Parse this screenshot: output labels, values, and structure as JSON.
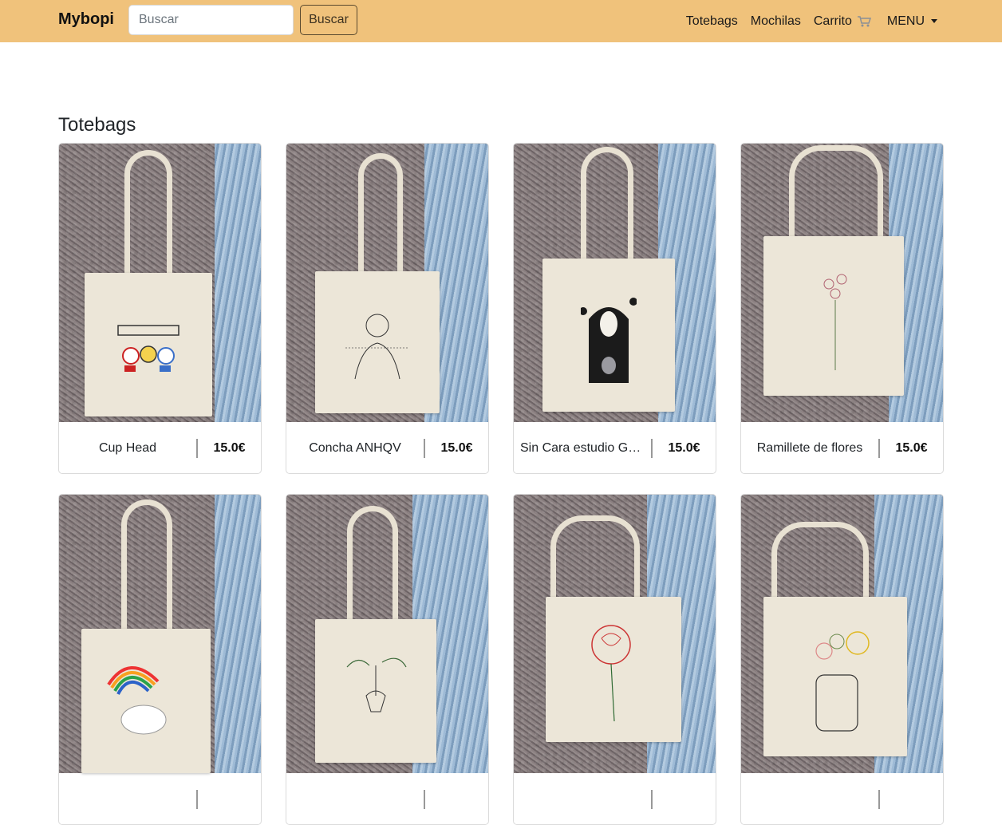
{
  "navbar": {
    "brand": "Mybopi",
    "search_placeholder": "Buscar",
    "search_button": "Buscar",
    "links": [
      "Totebags",
      "Mochilas",
      "Carrito",
      "MENU"
    ],
    "cart_icon": "cart-icon",
    "menu_icon": "caret-down-icon",
    "background": "#f0c27b"
  },
  "main": {
    "section_title": "Totebags",
    "products": [
      {
        "name": "Cup Head",
        "price": "15.0€"
      },
      {
        "name": "Concha ANHQV",
        "price": "15.0€"
      },
      {
        "name": "Sin Cara estudio Ghibli",
        "price": "15.0€"
      },
      {
        "name": "Ramillete de flores",
        "price": "15.0€"
      },
      {
        "name": "",
        "price": ""
      },
      {
        "name": "",
        "price": ""
      },
      {
        "name": "",
        "price": ""
      },
      {
        "name": "",
        "price": ""
      }
    ]
  }
}
